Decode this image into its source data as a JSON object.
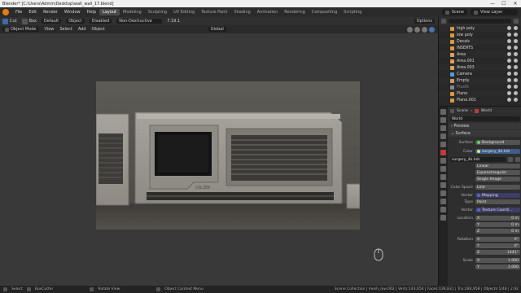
{
  "window": {
    "title": "Blender* [C:\\Users\\Admin\\Desktop\\wall_wall_17.blend]",
    "controls": [
      "—",
      "☐",
      "✕"
    ]
  },
  "menubar": {
    "items": [
      "File",
      "Edit",
      "Render",
      "Window",
      "Help"
    ],
    "workspaces": [
      "Layout",
      "Modeling",
      "Sculpting",
      "UV Editing",
      "Texture Paint",
      "Shading",
      "Animation",
      "Rendering",
      "Compositing",
      "Scripting"
    ],
    "active_workspace": "Layout",
    "scene": "Scene",
    "view_layer": "View Layer"
  },
  "header1": {
    "tool": "Cut",
    "box": "Box",
    "orientation": "Default",
    "object": "Object",
    "disabled": "Disabled",
    "mode": "Non-Destructive",
    "version": "7.19.1",
    "options": "Options"
  },
  "header2": {
    "mode": "Object Mode",
    "menus": [
      "View",
      "Select",
      "Add",
      "Object"
    ],
    "transform": "Global"
  },
  "render": {
    "label_text": "COLZER"
  },
  "statusbar": {
    "items": [
      "Select",
      "BoxCutter",
      "Rotate View",
      "Object Context Menu"
    ],
    "stats": "Scene Collection | mesh_low.002 | Verts:143,654 | Faces:136,831 | Tris:284,958 | Objects:1/48 | 2.92"
  },
  "outliner": {
    "items": [
      {
        "name": "high poly",
        "color": "#d89a3c"
      },
      {
        "name": "low poly",
        "color": "#d89a3c"
      },
      {
        "name": "Decals",
        "color": "#d89a3c"
      },
      {
        "name": "INSERTS",
        "color": "#d89a3c"
      },
      {
        "name": "Area",
        "color": "#e0a05a"
      },
      {
        "name": "Area.001",
        "color": "#e0a05a"
      },
      {
        "name": "Area.003",
        "color": "#e0a05a"
      },
      {
        "name": "Camera",
        "color": "#5a9ad8"
      },
      {
        "name": "Empty",
        "color": "#c99a6a"
      },
      {
        "name": "Frustit",
        "color": "#888888"
      },
      {
        "name": "Plane",
        "color": "#d89a3c"
      },
      {
        "name": "Plane.001",
        "color": "#d89a3c"
      }
    ]
  },
  "properties": {
    "breadcrumb_scene": "Scene",
    "breadcrumb_world": "World",
    "world_name": "World",
    "panels": {
      "preview": "Preview",
      "surface": "Surface"
    },
    "surface_label": "Surface",
    "surface_value": "Background",
    "color_label": "Color",
    "color_value": "surgery_4k.hdr",
    "image_name": "surgery_4k.hdr",
    "interp": "Linear",
    "projection": "Equirectangular",
    "source": "Single Image",
    "color_space_label": "Color Space",
    "color_space_value": "Line",
    "vector1_label": "Vector",
    "vector1_value": "Mapping",
    "type_label": "Type",
    "type_value": "Point",
    "vector2_label": "Vector",
    "vector2_value": "Texture Coordi...",
    "location_label": "Location",
    "location": {
      "x": "0 m",
      "y": "0 m",
      "z": "0 m"
    },
    "rotation_label": "Rotation",
    "rotation": {
      "x": "0°",
      "y": "0°",
      "z": "1441°"
    },
    "scale_label": "Scale",
    "scale": {
      "x": "1.000",
      "y": "1.000"
    },
    "axis_x": "X",
    "axis_y": "Y",
    "axis_z": "Z"
  }
}
